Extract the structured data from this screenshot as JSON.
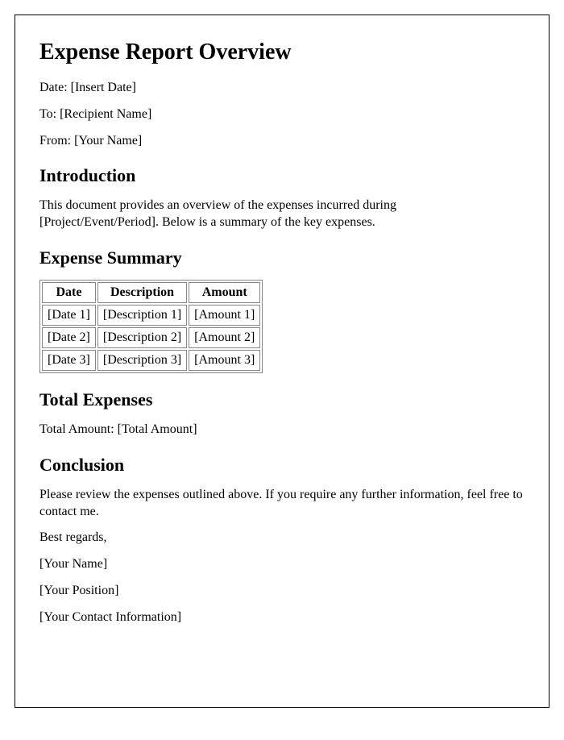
{
  "title": "Expense Report Overview",
  "meta": {
    "date_label": "Date: [Insert Date]",
    "to_label": "To: [Recipient Name]",
    "from_label": "From: [Your Name]"
  },
  "introduction": {
    "heading": "Introduction",
    "body": "This document provides an overview of the expenses incurred during [Project/Event/Period]. Below is a summary of the key expenses."
  },
  "summary": {
    "heading": "Expense Summary",
    "headers": [
      "Date",
      "Description",
      "Amount"
    ],
    "rows": [
      [
        "[Date 1]",
        "[Description 1]",
        "[Amount 1]"
      ],
      [
        "[Date 2]",
        "[Description 2]",
        "[Amount 2]"
      ],
      [
        "[Date 3]",
        "[Description 3]",
        "[Amount 3]"
      ]
    ]
  },
  "total": {
    "heading": "Total Expenses",
    "line": "Total Amount: [Total Amount]"
  },
  "conclusion": {
    "heading": "Conclusion",
    "body": "Please review the expenses outlined above. If you require any further information, feel free to contact me.",
    "regards": "Best regards,",
    "name": "[Your Name]",
    "position": "[Your Position]",
    "contact": "[Your Contact Information]"
  }
}
